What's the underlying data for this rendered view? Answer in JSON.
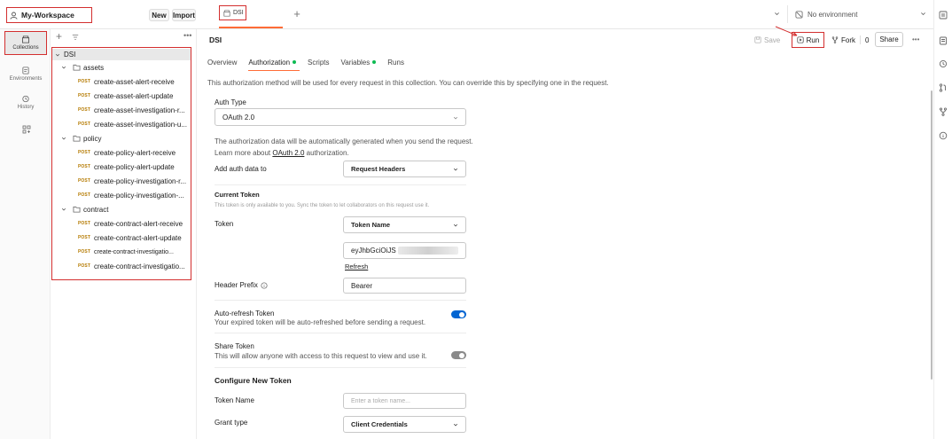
{
  "workspace": {
    "name": "My-Workspace",
    "new_label": "New",
    "import_label": "Import"
  },
  "tabs": [
    {
      "label": "DSI"
    }
  ],
  "environment": {
    "label": "No environment"
  },
  "left_rail": [
    {
      "label": "Collections",
      "icon": "collections-icon"
    },
    {
      "label": "Environments",
      "icon": "environments-icon"
    },
    {
      "label": "History",
      "icon": "history-icon"
    },
    {
      "label": "",
      "icon": "apps-icon"
    }
  ],
  "sidebar": {
    "collection": "DSI",
    "folders": [
      {
        "name": "assets",
        "requests": [
          {
            "method": "POST",
            "name": "create-asset-alert-receive"
          },
          {
            "method": "POST",
            "name": "create-asset-alert-update"
          },
          {
            "method": "POST",
            "name": "create-asset-investigation-r..."
          },
          {
            "method": "POST",
            "name": "create-asset-investigation-u..."
          }
        ]
      },
      {
        "name": "policy",
        "requests": [
          {
            "method": "POST",
            "name": "create-policy-alert-receive"
          },
          {
            "method": "POST",
            "name": "create-policy-alert-update"
          },
          {
            "method": "POST",
            "name": "create-policy-investigation-r..."
          },
          {
            "method": "POST",
            "name": "create-policy-investigation-..."
          }
        ]
      },
      {
        "name": "contract",
        "requests": [
          {
            "method": "POST",
            "name": "create-contract-alert-receive"
          },
          {
            "method": "POST",
            "name": "create-contract-alert-update"
          },
          {
            "method": "POST",
            "name": "create-contract-investigatio..."
          },
          {
            "method": "POST",
            "name": "create-contract-investigatio..."
          }
        ]
      }
    ]
  },
  "main": {
    "title": "DSI",
    "save_label": "Save",
    "run_label": "Run",
    "fork_label": "Fork",
    "fork_count": "0",
    "share_label": "Share",
    "subtabs": [
      {
        "label": "Overview"
      },
      {
        "label": "Authorization"
      },
      {
        "label": "Scripts"
      },
      {
        "label": "Variables"
      },
      {
        "label": "Runs"
      }
    ],
    "info_text": "This authorization method will be used for every request in this collection. You can override this by specifying one in the request.",
    "auth_type_label": "Auth Type",
    "auth_type_value": "OAuth 2.0",
    "auth_desc_1": "The authorization data will be automatically generated when you send the request.",
    "auth_desc_2_pre": "Learn more about ",
    "auth_desc_2_link": "OAuth 2.0",
    "auth_desc_2_post": " authorization.",
    "add_auth_label": "Add auth data to",
    "add_auth_value": "Request Headers",
    "current_token_heading": "Current Token",
    "current_token_note": "This token is only available to you. Sync the token to let collaborators on this request use it.",
    "token_label": "Token",
    "token_select": "Token Name",
    "token_value": "eyJhbGciOiJS",
    "refresh_label": "Refresh",
    "header_prefix_label": "Header Prefix",
    "header_prefix_value": "Bearer",
    "auto_refresh_title": "Auto-refresh Token",
    "auto_refresh_desc": "Your expired token will be auto-refreshed before sending a request.",
    "share_token_title": "Share Token",
    "share_token_desc": "This will allow anyone with access to this request to view and use it.",
    "configure_heading": "Configure New Token",
    "token_name_label": "Token Name",
    "token_name_placeholder": "Enter a token name...",
    "grant_type_label": "Grant type",
    "grant_type_value": "Client Credentials"
  },
  "colors": {
    "accent": "#ff6c37",
    "toggle_on": "#0265d2",
    "status_green": "#0cbb52",
    "post": "#b57a00",
    "highlight": "#d32f2f"
  }
}
